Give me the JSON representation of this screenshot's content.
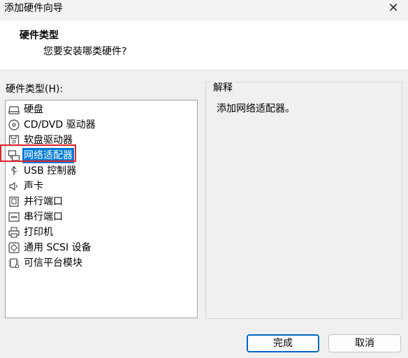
{
  "window": {
    "title": "添加硬件向导",
    "close_icon": "close-icon"
  },
  "header": {
    "title": "硬件类型",
    "subtitle": "您要安装哪类硬件?"
  },
  "hardware_list": {
    "label": "硬件类型(H):",
    "selected_index": 3,
    "items": [
      {
        "label": "硬盘",
        "icon": "hard-disk-icon"
      },
      {
        "label": "CD/DVD 驱动器",
        "icon": "cd-dvd-icon"
      },
      {
        "label": "软盘驱动器",
        "icon": "floppy-icon"
      },
      {
        "label": "网络适配器",
        "icon": "network-adapter-icon"
      },
      {
        "label": "USB 控制器",
        "icon": "usb-icon"
      },
      {
        "label": "声卡",
        "icon": "speaker-icon"
      },
      {
        "label": "并行端口",
        "icon": "parallel-port-icon"
      },
      {
        "label": "串行端口",
        "icon": "serial-port-icon"
      },
      {
        "label": "打印机",
        "icon": "printer-icon"
      },
      {
        "label": "通用 SCSI 设备",
        "icon": "scsi-icon"
      },
      {
        "label": "可信平台模块",
        "icon": "tpm-icon"
      }
    ]
  },
  "description": {
    "title": "解释",
    "text": "添加网络适配器。"
  },
  "buttons": {
    "finish": "完成",
    "cancel": "取消"
  },
  "colors": {
    "selection": "#0078d7",
    "highlight_border": "#e0242b",
    "primary_button_border": "#0067c0"
  }
}
